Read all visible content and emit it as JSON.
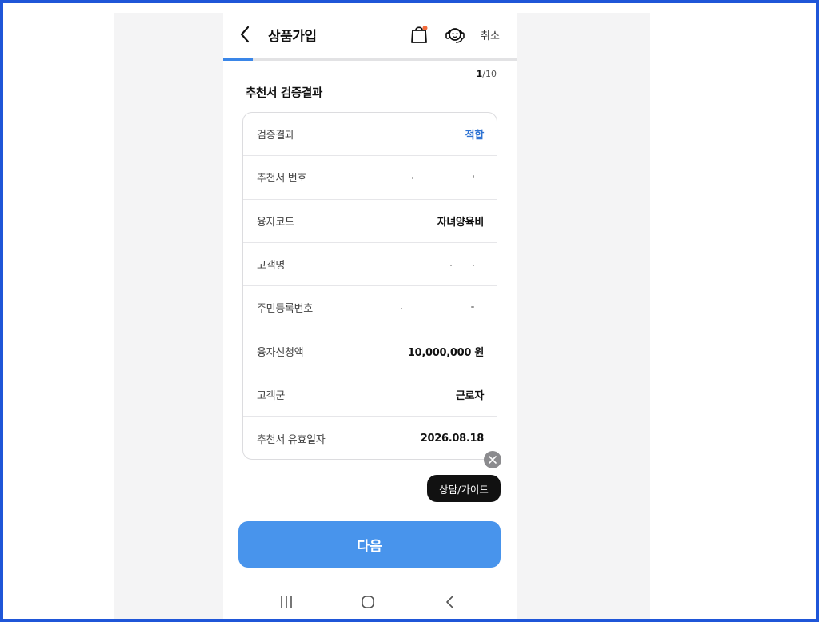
{
  "header": {
    "title": "상품가입",
    "cancel_label": "취소"
  },
  "progress": {
    "current": "1",
    "total": "/10",
    "fraction": 0.1
  },
  "section_title": "추천서 검증결과",
  "rows": [
    {
      "label": "검증결과",
      "value": "적합"
    },
    {
      "label": "추천서 번호",
      "value": ""
    },
    {
      "label": "융자코드",
      "value": "자녀양육비"
    },
    {
      "label": "고객명",
      "value": ""
    },
    {
      "label": "주민등록번호",
      "value": ""
    },
    {
      "label": "융자신청액",
      "value": "10,000,000 원"
    },
    {
      "label": "고객군",
      "value": "근로자"
    },
    {
      "label": "추천서 유효일자",
      "value": "2026.08.18"
    }
  ],
  "floating": {
    "guide_label": "상담/가이드"
  },
  "next_label": "다음",
  "colors": {
    "accent": "#2d72d2",
    "primary_button": "#4894ec",
    "progress": "#3a86e8",
    "notification_dot": "#f26a3a"
  },
  "icons": {
    "back": "chevron-left-icon",
    "bag": "shopping-bag-icon",
    "support": "headset-icon",
    "close": "close-icon",
    "nav_recents": "recents-icon",
    "nav_home": "home-icon",
    "nav_back": "back-icon"
  }
}
